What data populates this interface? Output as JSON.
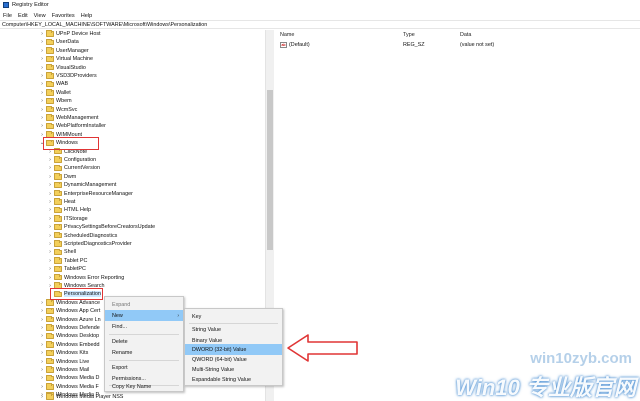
{
  "window": {
    "title": "Registry Editor",
    "accent": "#2a6fd0"
  },
  "menubar": [
    "File",
    "Edit",
    "View",
    "Favorites",
    "Help"
  ],
  "address": "Computer\\HKEY_LOCAL_MACHINE\\SOFTWARE\\Microsoft\\Windows\\Personalization",
  "tree": {
    "level1": [
      "UPnP Device Host",
      "UserData",
      "UserManager",
      "Virtual Machine",
      "VisualStudio",
      "VSD3DProviders",
      "WAB",
      "Wallet",
      "Wbem",
      "WcmSvc",
      "WebManagement",
      "WebPlatformInstaller",
      "WIMMount",
      "Windows"
    ],
    "level2": [
      "ClickNote",
      "Configuration",
      "CurrentVersion",
      "Dwm",
      "DynamicManagement",
      "EnterpriseResourceManager",
      "Heat",
      "HTML Help",
      "ITStorage",
      "PrivacySettingsBeforeCreatorsUpdate",
      "ScheduledDiagnostics",
      "ScriptedDiagnosticsProvider",
      "Shell",
      "Tablet PC",
      "TabletPC",
      "Windows Error Reporting",
      "Windows Search",
      "Personalization"
    ],
    "level1_after": [
      "Windows Advance",
      "Windows App Cert",
      "Windows Azure Ln",
      "Windows Defende",
      "Windows Desktop",
      "Windows Embedd",
      "Windows Kits",
      "Windows Live",
      "Windows Mail",
      "Windows Media D",
      "Windows Media F",
      "Windows Media P",
      "Windows Media Player NSS"
    ]
  },
  "values_pane": {
    "headers": {
      "name": "Name",
      "type": "Type",
      "data": "Data"
    },
    "rows": [
      {
        "icon": "ab",
        "name": "(Default)",
        "type": "REG_SZ",
        "data": "(value not set)"
      }
    ]
  },
  "context_menu": {
    "items": [
      "Expand",
      "New",
      "Find...",
      "Delete",
      "Rename",
      "Export",
      "Permissions...",
      "Copy Key Name"
    ],
    "selected": "New"
  },
  "new_submenu": {
    "items": [
      "Key",
      "String Value",
      "Binary Value",
      "DWORD (32-bit) Value",
      "QWORD (64-bit) Value",
      "Multi-String Value",
      "Expandable String Value"
    ],
    "selected": "DWORD (32-bit) Value"
  },
  "annotation": {
    "color": "#e03535"
  },
  "watermark": {
    "line1": "win10zyb.com",
    "line2": "Win10 专业版官网"
  }
}
